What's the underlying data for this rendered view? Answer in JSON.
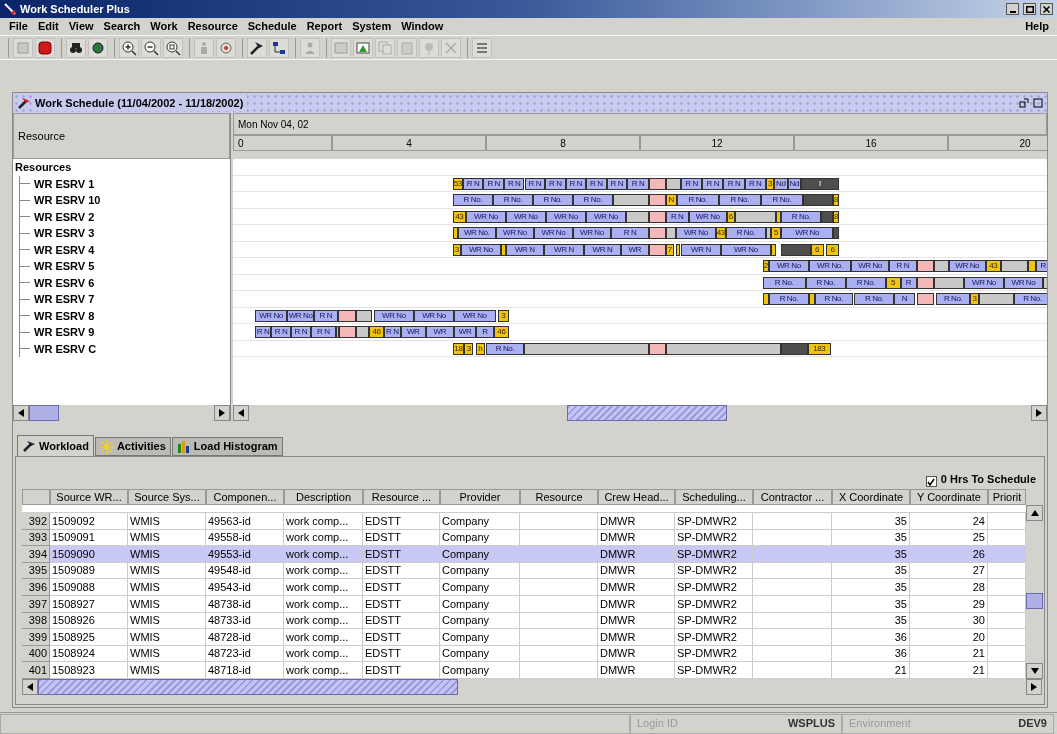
{
  "window": {
    "title": "Work Scheduler Plus"
  },
  "menu": {
    "items": [
      "File",
      "Edit",
      "View",
      "Search",
      "Work",
      "Resource",
      "Schedule",
      "Report",
      "System",
      "Window"
    ],
    "help": "Help"
  },
  "schedule": {
    "title": "Work Schedule (11/04/2002 - 11/18/2002)",
    "resource_header": "Resource",
    "date": "Mon Nov 04, 02",
    "hours": [
      "0",
      "4",
      "8",
      "12",
      "16",
      "20"
    ],
    "tree": {
      "label": "Resources",
      "children": [
        {
          "label": "WR ESRV 1",
          "segments": [
            {
              "kind": "marker",
              "label": "53"
            },
            {
              "kind": "job",
              "label": "R N"
            },
            {
              "kind": "job",
              "label": "R N"
            },
            {
              "kind": "job",
              "label": "R N"
            },
            {
              "kind": "job",
              "label": "R N"
            },
            {
              "kind": "job",
              "label": "R N"
            },
            {
              "kind": "job",
              "label": "R N"
            },
            {
              "kind": "job",
              "label": "R N"
            },
            {
              "kind": "job",
              "label": "R N"
            },
            {
              "kind": "job",
              "label": "R N"
            },
            {
              "kind": "break"
            },
            {
              "kind": "idle"
            },
            {
              "kind": "job",
              "label": "R N"
            },
            {
              "kind": "job",
              "label": "R N"
            },
            {
              "kind": "job",
              "label": "R N"
            },
            {
              "kind": "job",
              "label": "R N"
            },
            {
              "kind": "marker",
              "label": "3"
            },
            {
              "kind": "job",
              "label": "Nd"
            },
            {
              "kind": "job",
              "label": "Nd"
            },
            {
              "kind": "busy",
              "label": "I"
            }
          ]
        },
        {
          "label": "WR ESRV 10",
          "segments": [
            {
              "kind": "job",
              "label": "R No."
            },
            {
              "kind": "job",
              "label": "R No."
            },
            {
              "kind": "job",
              "label": "R No."
            },
            {
              "kind": "job",
              "label": "R No."
            },
            {
              "kind": "idle"
            },
            {
              "kind": "break"
            },
            {
              "kind": "marker",
              "label": "N"
            },
            {
              "kind": "job",
              "label": "R No."
            },
            {
              "kind": "job",
              "label": "R No."
            },
            {
              "kind": "job",
              "label": "R No."
            },
            {
              "kind": "busy"
            },
            {
              "kind": "marker",
              "label": "8"
            }
          ]
        },
        {
          "label": "WR ESRV 2",
          "segments": [
            {
              "kind": "marker",
              "label": "43"
            },
            {
              "kind": "job",
              "label": "WR No"
            },
            {
              "kind": "job",
              "label": "WR No"
            },
            {
              "kind": "job",
              "label": "WR No"
            },
            {
              "kind": "job",
              "label": "WR No"
            },
            {
              "kind": "idle"
            },
            {
              "kind": "break"
            },
            {
              "kind": "job",
              "label": "R N"
            },
            {
              "kind": "job",
              "label": "WR No"
            },
            {
              "kind": "marker",
              "label": "6"
            },
            {
              "kind": "idle"
            },
            {
              "kind": "marker"
            },
            {
              "kind": "job",
              "label": "R No."
            },
            {
              "kind": "busy"
            },
            {
              "kind": "marker",
              "label": "8"
            }
          ]
        },
        {
          "label": "WR ESRV 3",
          "segments": [
            {
              "kind": "marker"
            },
            {
              "kind": "job",
              "label": "WR No."
            },
            {
              "kind": "job",
              "label": "WR No"
            },
            {
              "kind": "job",
              "label": "WR No"
            },
            {
              "kind": "job",
              "label": "WR No"
            },
            {
              "kind": "job",
              "label": "R N"
            },
            {
              "kind": "break"
            },
            {
              "kind": "idle"
            },
            {
              "kind": "job",
              "label": "WR No"
            },
            {
              "kind": "marker",
              "label": "43"
            },
            {
              "kind": "job",
              "label": "R No."
            },
            {
              "kind": "idle"
            },
            {
              "kind": "marker",
              "label": "5"
            },
            {
              "kind": "job",
              "label": "WR No"
            },
            {
              "kind": "busy"
            }
          ]
        },
        {
          "label": "WR ESRV 4",
          "segments": [
            {
              "kind": "marker",
              "label": "3"
            },
            {
              "kind": "job",
              "label": "WR No"
            },
            {
              "kind": "marker"
            },
            {
              "kind": "job",
              "label": "WR N"
            },
            {
              "kind": "job",
              "label": "WR N"
            },
            {
              "kind": "job",
              "label": "WR N"
            },
            {
              "kind": "job",
              "label": "WR"
            },
            {
              "kind": "break"
            },
            {
              "kind": "marker",
              "label": "7"
            },
            {
              "kind": "marker"
            },
            {
              "kind": "job",
              "label": "WR N"
            },
            {
              "kind": "job",
              "label": "WR No"
            },
            {
              "kind": "marker"
            },
            {
              "kind": "busy"
            },
            {
              "kind": "marker",
              "label": "6"
            },
            {
              "kind": "marker",
              "label": "6"
            }
          ]
        },
        {
          "label": "WR ESRV 5",
          "segments": [
            {
              "kind": "marker",
              "label": "2"
            },
            {
              "kind": "job",
              "label": "WR No"
            },
            {
              "kind": "job",
              "label": "WR No."
            },
            {
              "kind": "job",
              "label": "WR No"
            },
            {
              "kind": "job",
              "label": "R N"
            },
            {
              "kind": "break"
            },
            {
              "kind": "idle"
            },
            {
              "kind": "job",
              "label": "WR No"
            },
            {
              "kind": "marker",
              "label": "43"
            },
            {
              "kind": "idle"
            },
            {
              "kind": "marker"
            },
            {
              "kind": "job",
              "label": "R"
            }
          ]
        },
        {
          "label": "WR ESRV 6",
          "segments": [
            {
              "kind": "job",
              "label": "R No."
            },
            {
              "kind": "job",
              "label": "R No."
            },
            {
              "kind": "job",
              "label": "R No."
            },
            {
              "kind": "marker",
              "label": "5"
            },
            {
              "kind": "job",
              "label": "R"
            },
            {
              "kind": "break"
            },
            {
              "kind": "idle"
            },
            {
              "kind": "job",
              "label": "WR No"
            },
            {
              "kind": "job",
              "label": "WR No"
            },
            {
              "kind": "idle"
            }
          ]
        },
        {
          "label": "WR ESRV 7",
          "segments": [
            {
              "kind": "marker"
            },
            {
              "kind": "job",
              "label": "R No."
            },
            {
              "kind": "marker"
            },
            {
              "kind": "job",
              "label": "R No."
            },
            {
              "kind": "job",
              "label": "R No."
            },
            {
              "kind": "job",
              "label": "N"
            },
            {
              "kind": "break"
            },
            {
              "kind": "job",
              "label": "R No."
            },
            {
              "kind": "marker",
              "label": "3"
            },
            {
              "kind": "idle"
            },
            {
              "kind": "job",
              "label": "R No."
            }
          ]
        },
        {
          "label": "WR ESRV 8",
          "segments": [
            {
              "kind": "job",
              "label": "WR No"
            },
            {
              "kind": "job",
              "label": "WR No"
            },
            {
              "kind": "job",
              "label": "R N"
            },
            {
              "kind": "break"
            },
            {
              "kind": "idle"
            },
            {
              "kind": "job",
              "label": "WR No"
            },
            {
              "kind": "job",
              "label": "WR No"
            },
            {
              "kind": "job",
              "label": "WR No"
            },
            {
              "kind": "marker",
              "label": "3"
            }
          ]
        },
        {
          "label": "WR ESRV 9",
          "segments": [
            {
              "kind": "job",
              "label": "R N"
            },
            {
              "kind": "job",
              "label": "R N"
            },
            {
              "kind": "job",
              "label": "R N"
            },
            {
              "kind": "job",
              "label": "R N"
            },
            {
              "kind": "marker"
            },
            {
              "kind": "break"
            },
            {
              "kind": "idle"
            },
            {
              "kind": "marker",
              "label": "46"
            },
            {
              "kind": "job",
              "label": "R N"
            },
            {
              "kind": "job",
              "label": "WR"
            },
            {
              "kind": "job",
              "label": "WR"
            },
            {
              "kind": "job",
              "label": "WR"
            },
            {
              "kind": "job",
              "label": "R"
            },
            {
              "kind": "marker",
              "label": "46"
            }
          ]
        },
        {
          "label": "WR ESRV C",
          "segments": [
            {
              "kind": "marker",
              "label": "18"
            },
            {
              "kind": "marker",
              "label": "3"
            },
            {
              "kind": "marker",
              "label": "h"
            },
            {
              "kind": "job",
              "label": "R No."
            },
            {
              "kind": "idle"
            },
            {
              "kind": "break"
            },
            {
              "kind": "idle"
            },
            {
              "kind": "busy"
            },
            {
              "kind": "marker",
              "label": "183"
            }
          ]
        }
      ]
    }
  },
  "tabs": [
    {
      "label": "Workload",
      "selected": true
    },
    {
      "label": "Activities",
      "selected": false
    },
    {
      "label": "Load Histogram",
      "selected": false
    }
  ],
  "workload": {
    "checkbox": {
      "label": "0 Hrs To Schedule",
      "checked": true
    },
    "table": {
      "columns": [
        {
          "label": "Source WR...",
          "kind": "text"
        },
        {
          "label": "Source Sys...",
          "kind": "text"
        },
        {
          "label": "Componen...",
          "kind": "text"
        },
        {
          "label": "Description",
          "kind": "text"
        },
        {
          "label": "Resource ...",
          "kind": "text"
        },
        {
          "label": "Provider",
          "kind": "text"
        },
        {
          "label": "Resource",
          "kind": "text"
        },
        {
          "label": "Crew Head...",
          "kind": "text"
        },
        {
          "label": "Scheduling...",
          "kind": "text"
        },
        {
          "label": "Contractor ...",
          "kind": "text"
        },
        {
          "label": "X Coordinate",
          "kind": "number"
        },
        {
          "label": "Y Coordinate",
          "kind": "number"
        },
        {
          "label": "Priorit",
          "kind": "number"
        }
      ],
      "rows": [
        {
          "number": "392",
          "selected": false,
          "cells": [
            "1509092",
            "WMIS",
            "49563-id",
            "work comp...",
            "EDSTT",
            "Company",
            null,
            "DMWR",
            "SP-DMWR2",
            null,
            "35",
            "24",
            null
          ]
        },
        {
          "number": "393",
          "selected": false,
          "cells": [
            "1509091",
            "WMIS",
            "49558-id",
            "work comp...",
            "EDSTT",
            "Company",
            null,
            "DMWR",
            "SP-DMWR2",
            null,
            "35",
            "25",
            null
          ]
        },
        {
          "number": "394",
          "selected": true,
          "cells": [
            "1509090",
            "WMIS",
            "49553-id",
            "work comp...",
            "EDSTT",
            "Company",
            null,
            "DMWR",
            "SP-DMWR2",
            null,
            "35",
            "26",
            null
          ]
        },
        {
          "number": "395",
          "selected": false,
          "cells": [
            "1509089",
            "WMIS",
            "49548-id",
            "work comp...",
            "EDSTT",
            "Company",
            null,
            "DMWR",
            "SP-DMWR2",
            null,
            "35",
            "27",
            null
          ]
        },
        {
          "number": "396",
          "selected": false,
          "cells": [
            "1509088",
            "WMIS",
            "49543-id",
            "work comp...",
            "EDSTT",
            "Company",
            null,
            "DMWR",
            "SP-DMWR2",
            null,
            "35",
            "28",
            null
          ]
        },
        {
          "number": "397",
          "selected": false,
          "cells": [
            "1508927",
            "WMIS",
            "48738-id",
            "work comp...",
            "EDSTT",
            "Company",
            null,
            "DMWR",
            "SP-DMWR2",
            null,
            "35",
            "29",
            null
          ]
        },
        {
          "number": "398",
          "selected": false,
          "cells": [
            "1508926",
            "WMIS",
            "48733-id",
            "work comp...",
            "EDSTT",
            "Company",
            null,
            "DMWR",
            "SP-DMWR2",
            null,
            "35",
            "30",
            null
          ]
        },
        {
          "number": "399",
          "selected": false,
          "cells": [
            "1508925",
            "WMIS",
            "48728-id",
            "work comp...",
            "EDSTT",
            "Company",
            null,
            "DMWR",
            "SP-DMWR2",
            null,
            "36",
            "20",
            null
          ]
        },
        {
          "number": "400",
          "selected": false,
          "cells": [
            "1508924",
            "WMIS",
            "48723-id",
            "work comp...",
            "EDSTT",
            "Company",
            null,
            "DMWR",
            "SP-DMWR2",
            null,
            "36",
            "21",
            null
          ]
        },
        {
          "number": "401",
          "selected": false,
          "cells": [
            "1508923",
            "WMIS",
            "48718-id",
            "work comp...",
            "EDSTT",
            "Company",
            null,
            "DMWR",
            "SP-DMWR2",
            null,
            "21",
            "21",
            null
          ]
        }
      ]
    }
  },
  "status_bar": [
    {
      "label": "Login ID",
      "value": "WSPLUS"
    },
    {
      "label": "Environment",
      "value": "DEV9"
    }
  ]
}
